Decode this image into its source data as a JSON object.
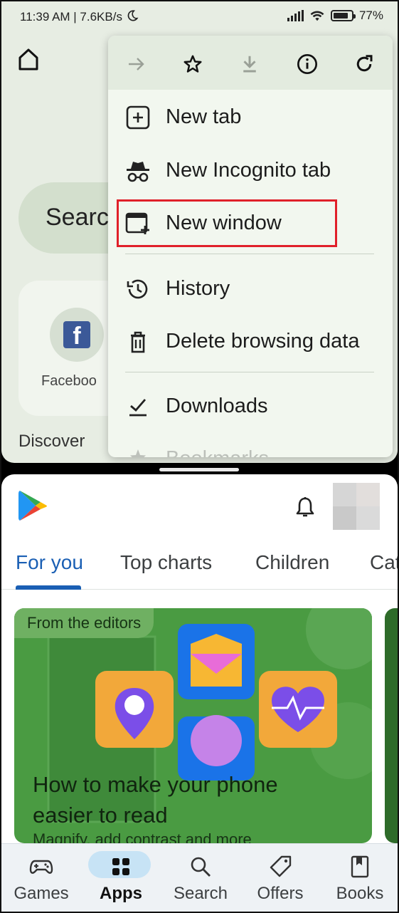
{
  "status_bar": {
    "time_speed": "11:39 AM | 7.6KB/s",
    "battery": "77"
  },
  "chrome": {
    "search_placeholder": "Searc",
    "shortcut_label": "Faceboo",
    "discover_label": "Discover",
    "menu": {
      "toolbar": [
        "forward-icon",
        "bookmark-star-icon",
        "download-icon",
        "info-icon",
        "refresh-icon"
      ],
      "items": [
        {
          "label": "New tab",
          "icon": "new-tab-icon"
        },
        {
          "label": "New Incognito tab",
          "icon": "incognito-icon"
        },
        {
          "label": "New window",
          "icon": "new-window-icon"
        },
        {
          "label": "History",
          "icon": "history-icon"
        },
        {
          "label": "Delete browsing data",
          "icon": "trash-icon"
        },
        {
          "label": "Downloads",
          "icon": "downloads-icon"
        },
        {
          "label": "Bookmarks",
          "icon": "bookmarks-icon"
        }
      ],
      "highlight_color": "#e0202a"
    }
  },
  "play": {
    "tabs": [
      "For you",
      "Top charts",
      "Children",
      "Cat"
    ],
    "active_tab": "For you",
    "feature": {
      "label": "From the editors",
      "title": "How to make your phone easier to read",
      "subtitle": "Magnify, add contrast and more"
    },
    "nav": [
      {
        "label": "Games",
        "icon": "gamepad-icon"
      },
      {
        "label": "Apps",
        "icon": "apps-grid-icon"
      },
      {
        "label": "Search",
        "icon": "search-icon"
      },
      {
        "label": "Offers",
        "icon": "tag-icon"
      },
      {
        "label": "Books",
        "icon": "book-icon"
      }
    ],
    "active_nav": "Apps",
    "accent_color": "#1a5fb4"
  }
}
